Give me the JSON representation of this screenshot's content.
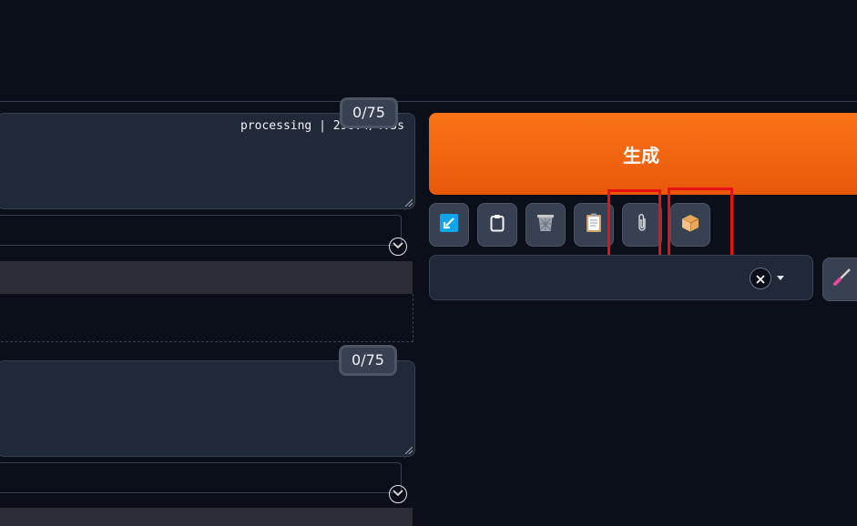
{
  "prompt": {
    "token_counter": "0/75",
    "progress_text": "processing | 296.4/4.5s"
  },
  "negative_prompt": {
    "token_counter": "0/75"
  },
  "actions": {
    "generate_label": "生成"
  },
  "tool_buttons": [
    {
      "icon": "arrow-in-box-icon",
      "accent": "#0ea5e9"
    },
    {
      "icon": "clipboard-icon"
    },
    {
      "icon": "trash-icon"
    },
    {
      "icon": "notepad-icon"
    },
    {
      "icon": "paperclip-icon"
    },
    {
      "icon": "package-icon",
      "accent": "#f59e0b"
    }
  ],
  "style_select": {
    "value": ""
  },
  "colors": {
    "background": "#0b0f19",
    "generate": "#f97316",
    "highlight": "#e81212"
  }
}
